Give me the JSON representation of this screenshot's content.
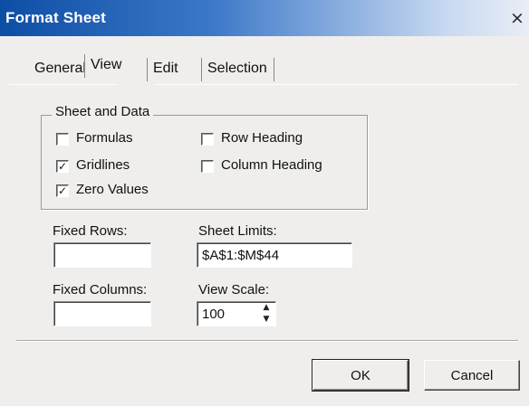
{
  "window": {
    "title": "Format Sheet",
    "close_glyph": "×"
  },
  "tabs": [
    {
      "label": "General",
      "active": false
    },
    {
      "label": "View",
      "active": true
    },
    {
      "label": "Edit",
      "active": false
    },
    {
      "label": "Selection",
      "active": false
    }
  ],
  "sheet_and_data": {
    "label": "Sheet and Data",
    "options": [
      {
        "label": "Formulas",
        "checked": false,
        "check_glyph": ""
      },
      {
        "label": "Gridlines",
        "checked": true,
        "check_glyph": "✓"
      },
      {
        "label": "Zero Values",
        "checked": true,
        "check_glyph": "✓"
      },
      {
        "label": "Row Heading",
        "checked": false,
        "check_glyph": ""
      },
      {
        "label": "Column Heading",
        "checked": false,
        "check_glyph": ""
      }
    ]
  },
  "fields": {
    "fixed_rows": {
      "label": "Fixed Rows:",
      "value": ""
    },
    "fixed_columns": {
      "label": "Fixed Columns:",
      "value": ""
    },
    "sheet_limits": {
      "label": "Sheet Limits:",
      "value": "$A$1:$M$44"
    },
    "view_scale": {
      "label": "View Scale:",
      "value": "100",
      "spin_up": "▲",
      "spin_down": "▼"
    }
  },
  "buttons": {
    "ok": "OK",
    "cancel": "Cancel"
  },
  "colors": {
    "titlebar_start": "#0d4ea5",
    "dialog_face": "#efeeec"
  }
}
